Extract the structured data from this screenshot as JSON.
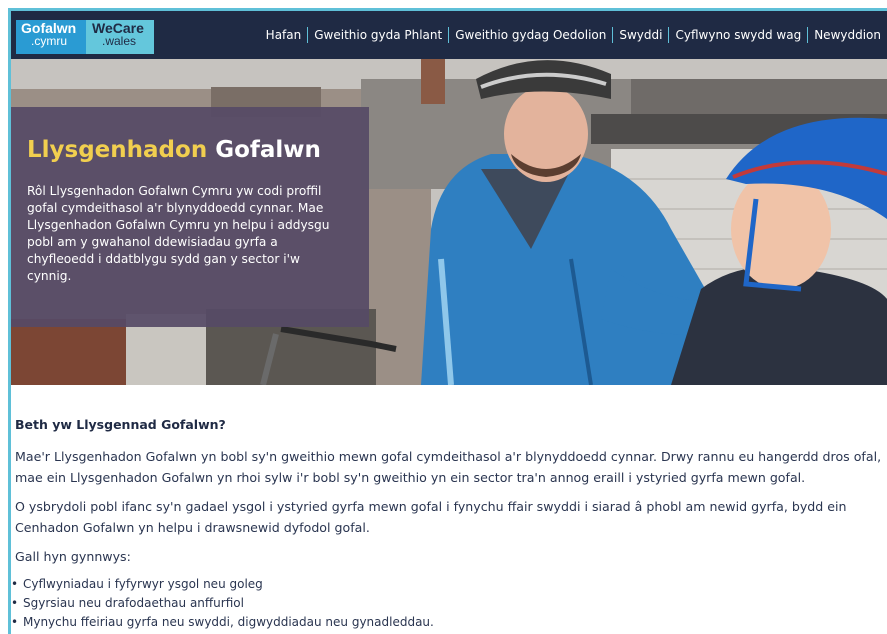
{
  "logo": {
    "left_top": "Gofalwn",
    "left_bottom": ".cymru",
    "right_top": "WeCare",
    "right_bottom": ".wales"
  },
  "nav": [
    "Hafan",
    "Gweithio gyda Phlant",
    "Gweithio gydag Oedolion",
    "Swyddi",
    "Cyflwyno swydd wag",
    "Newyddion"
  ],
  "hero": {
    "title_highlight": "Llysgenhadon",
    "title_rest": "Gofalwn",
    "text": "Rôl Llysgenhadon Gofalwn Cymru yw codi proffil gofal cymdeithasol a'r blynyddoedd cynnar. Mae Llysgenhadon Gofalwn Cymru yn helpu i addysgu pobl am y gwahanol ddewisiadau gyrfa a chyfleoedd i ddatblygu sydd gan y sector i'w cynnig."
  },
  "content": {
    "heading": "Beth yw Llysgennad Gofalwn?",
    "para1": "Mae'r Llysgenhadon Gofalwn yn bobl sy'n gweithio mewn gofal cymdeithasol a'r blynyddoedd cynnar. Drwy rannu eu hangerdd dros ofal, mae ein Llysgenhadon Gofalwn yn rhoi sylw i'r bobl sy'n gweithio yn ein sector tra'n annog eraill i ystyried gyrfa mewn gofal.",
    "para2": "O ysbrydoli pobl ifanc sy'n gadael ysgol i ystyried gyrfa mewn gofal i fynychu ffair swyddi i siarad â phobl am newid gyrfa, bydd ein Cenhadon Gofalwn yn helpu i drawsnewid dyfodol gofal.",
    "para3": "Gall hyn gynnwys:",
    "list": [
      "Cyflwyniadau i fyfyrwyr ysgol neu goleg",
      "Sgyrsiau neu drafodaethau anffurfiol",
      "Mynychu ffeiriau gyrfa neu swyddi, digwyddiadau neu gynadleddau."
    ]
  },
  "colors": {
    "navy": "#1f2a44",
    "accent_blue": "#2a9bd3",
    "accent_teal": "#64c7dc",
    "title_yellow": "#f1cf4f",
    "panel_purple": "#564a66"
  }
}
